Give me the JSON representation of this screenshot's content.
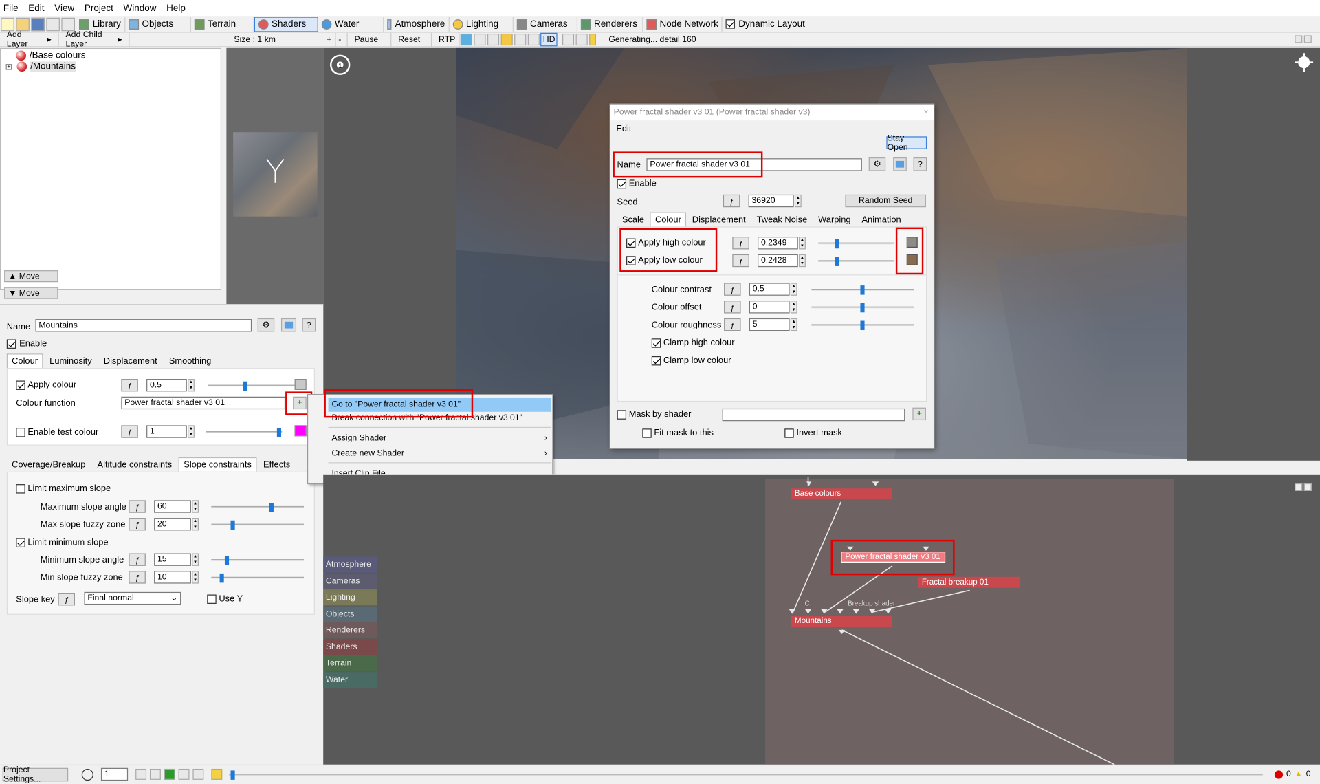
{
  "menu": [
    "File",
    "Edit",
    "View",
    "Project",
    "Window",
    "Help"
  ],
  "toolbar": {
    "tabs": [
      "Library",
      "Objects",
      "Terrain",
      "Shaders",
      "Water",
      "Atmosphere",
      "Lighting",
      "Cameras",
      "Renderers",
      "Node Network"
    ],
    "dynamic_layout": "Dynamic Layout"
  },
  "secondbar": {
    "add_layer": "Add Layer",
    "add_child": "Add Child Layer",
    "size": "Size : 1 km",
    "pause": "Pause",
    "reset": "Reset",
    "rtp": "RTP",
    "status": "Generating... detail 160",
    "hd": "HD"
  },
  "layers": [
    "/Base colours",
    "/Mountains"
  ],
  "move": [
    "Move",
    "Move"
  ],
  "panel": {
    "name_label": "Name",
    "name_value": "Mountains",
    "enable": "Enable",
    "tabs": [
      "Colour",
      "Luminosity",
      "Displacement",
      "Smoothing"
    ],
    "apply_colour": "Apply colour",
    "apply_colour_val": "0.5",
    "colour_function": "Colour function",
    "colour_function_val": "Power fractal shader v3 01",
    "enable_test": "Enable test colour",
    "enable_test_val": "1",
    "tabs2": [
      "Coverage/Breakup",
      "Altitude constraints",
      "Slope constraints",
      "Effects"
    ],
    "limit_max": "Limit maximum slope",
    "max_angle": "Maximum slope angle",
    "max_angle_val": "60",
    "max_fuzzy": "Max slope fuzzy zone",
    "max_fuzzy_val": "20",
    "limit_min": "Limit minimum slope",
    "min_angle": "Minimum slope angle",
    "min_angle_val": "15",
    "min_fuzzy": "Min slope fuzzy zone",
    "min_fuzzy_val": "10",
    "slope_key": "Slope key",
    "slope_key_val": "Final normal",
    "use_y": "Use Y"
  },
  "context_menu": [
    "Go to \"Power fractal shader v3 01\"",
    "Break connection with \"Power fractal shader v3 01\"",
    "Assign Shader",
    "Create new Shader",
    "Insert Clip File..."
  ],
  "dialog": {
    "title": "Power fractal shader v3 01   (Power fractal shader v3)",
    "menu": "Edit",
    "stay_open": "Stay Open",
    "name_label": "Name",
    "name_value": "Power fractal shader v3 01",
    "enable": "Enable",
    "seed": "Seed",
    "seed_val": "36920",
    "random_seed": "Random Seed",
    "tabs": [
      "Scale",
      "Colour",
      "Displacement",
      "Tweak Noise",
      "Warping",
      "Animation"
    ],
    "apply_high": "Apply high colour",
    "apply_high_val": "0.2349",
    "apply_low": "Apply low colour",
    "apply_low_val": "0.2428",
    "contrast": "Colour contrast",
    "contrast_val": "0.5",
    "offset": "Colour offset",
    "offset_val": "0",
    "roughness": "Colour roughness",
    "roughness_val": "5",
    "clamp_high": "Clamp high colour",
    "clamp_low": "Clamp low colour",
    "mask": "Mask by shader",
    "fit_mask": "Fit mask to this",
    "invert_mask": "Invert mask"
  },
  "palette": [
    "Atmosphere",
    "Cameras",
    "Lighting",
    "Objects",
    "Renderers",
    "Shaders",
    "Terrain",
    "Water"
  ],
  "nodes": {
    "base": "Base colours",
    "pfs": "Power fractal shader v3 01",
    "breakup": "Fractal breakup 01",
    "mountains": "Mountains",
    "c": "C",
    "breakup_shader": "Breakup shader"
  },
  "bottom": {
    "project_settings": "Project Settings...",
    "frame": "1",
    "errors": "0",
    "warnings": "0"
  },
  "colors": {
    "palette": [
      "#5a5a7a",
      "#5c5c6e",
      "#7a7a58",
      "#5a6a74",
      "#6e5a5a",
      "#7a4a4a",
      "#4a6a4a",
      "#4a6a64"
    ]
  }
}
